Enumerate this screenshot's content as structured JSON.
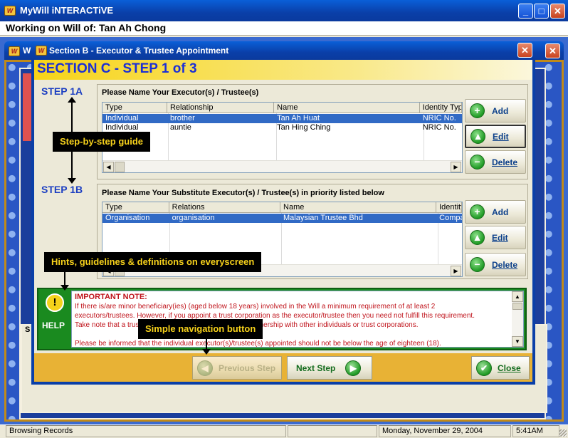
{
  "app": {
    "title": "MyWill iNTERACTiVE",
    "logo_text": "W"
  },
  "working_bar": {
    "text": "Working on Will of: Tan Ah Chong"
  },
  "back_window": {
    "title_stub": "W",
    "left_label_stub": "S"
  },
  "dialog": {
    "title": "Section B - Executor & Trustee Appointment",
    "heading": "SECTION C - STEP 1 of 3",
    "step1a": {
      "label": "STEP 1A",
      "panel_title": "Please Name Your Executor(s) / Trustee(s)",
      "columns": [
        "Type",
        "Relationship",
        "Name",
        "Identity Type"
      ],
      "rows": [
        {
          "type": "Individual",
          "relationship": "brother",
          "name": "Tan Ah Huat",
          "identity": "NRIC No."
        },
        {
          "type": "Individual",
          "relationship": "auntie",
          "name": "Tan Hing Ching",
          "identity": "NRIC No."
        }
      ],
      "buttons": {
        "add": "Add",
        "edit": "Edit",
        "delete": "Delete"
      }
    },
    "step1b": {
      "label": "STEP 1B",
      "panel_title": "Please Name Your Substitute Executor(s) / Trustee(s) in priority listed below",
      "columns": [
        "Type",
        "Relations",
        "Name",
        "Identity"
      ],
      "rows": [
        {
          "type": "Organisation",
          "relationship": "organisation",
          "name": "Malaysian Trustee Bhd",
          "identity": "Company"
        }
      ],
      "buttons": {
        "add": "Add",
        "edit": "Edit",
        "delete": "Delete"
      }
    },
    "help": {
      "label": "HELP",
      "note_title": "IMPORTANT NOTE:",
      "note_lines": [
        "If there is/are minor beneficiary(ies) (aged below 18 years) involved in the Will a minimum requirement of at least 2",
        "executors/trustees. However, if you appoint a trust corporation as the executor/trustee then you need not fulfill this requirement.",
        "Take note that a trust corporation may not act jointly in partnership with other individuals or trust corporations.",
        "",
        "Please be informed that the individual executor(s)/trustee(s) appointed should not be below the age of eighteen (18)."
      ]
    },
    "nav": {
      "previous": "Previous Step",
      "next": "Next Step",
      "close": "Close"
    }
  },
  "callouts": {
    "guide": "Step-by-step guide",
    "hints": "Hints, guidelines & definitions on everyscreen",
    "nav": "Simple navigation button"
  },
  "status_bar": {
    "left": "Browsing Records",
    "date": "Monday, November 29, 2004",
    "time": "5:41AM"
  },
  "colors": {
    "heading_bg": "#f7d418",
    "heading_text": "#1b2fd6",
    "help_green": "#1a8a1f",
    "note_red": "#c0141c",
    "selection": "#316ac5"
  }
}
